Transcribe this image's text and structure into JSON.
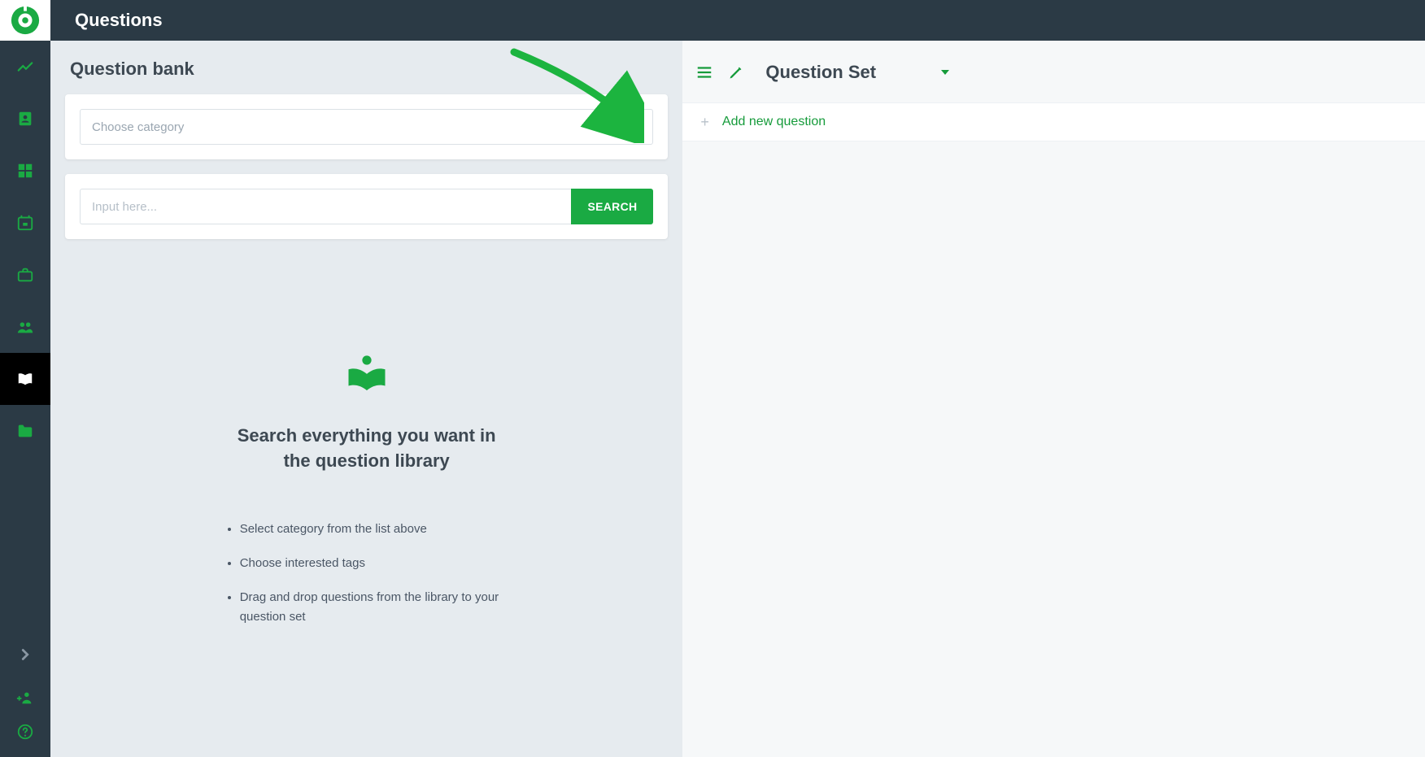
{
  "header": {
    "title": "Questions"
  },
  "sidebar": {
    "items": [
      {
        "name": "analytics"
      },
      {
        "name": "contact"
      },
      {
        "name": "dashboard"
      },
      {
        "name": "calendar"
      },
      {
        "name": "briefcase"
      },
      {
        "name": "people"
      },
      {
        "name": "library",
        "active": true
      },
      {
        "name": "folder"
      }
    ],
    "expand": "expand",
    "bottom": [
      {
        "name": "invite"
      },
      {
        "name": "help"
      }
    ]
  },
  "left": {
    "heading": "Question bank",
    "category_placeholder": "Choose category",
    "search_placeholder": "Input here...",
    "search_button": "SEARCH",
    "empty": {
      "heading_line1": "Search everything you want in",
      "heading_line2": "the question library",
      "bullets": [
        "Select category from the list above",
        "Choose interested tags",
        "Drag and drop questions from the library to your question set"
      ]
    }
  },
  "right": {
    "title": "Question Set",
    "add_label": "Add new question"
  },
  "colors": {
    "accent": "#169b3b",
    "sidebar": "#2b3a45"
  }
}
